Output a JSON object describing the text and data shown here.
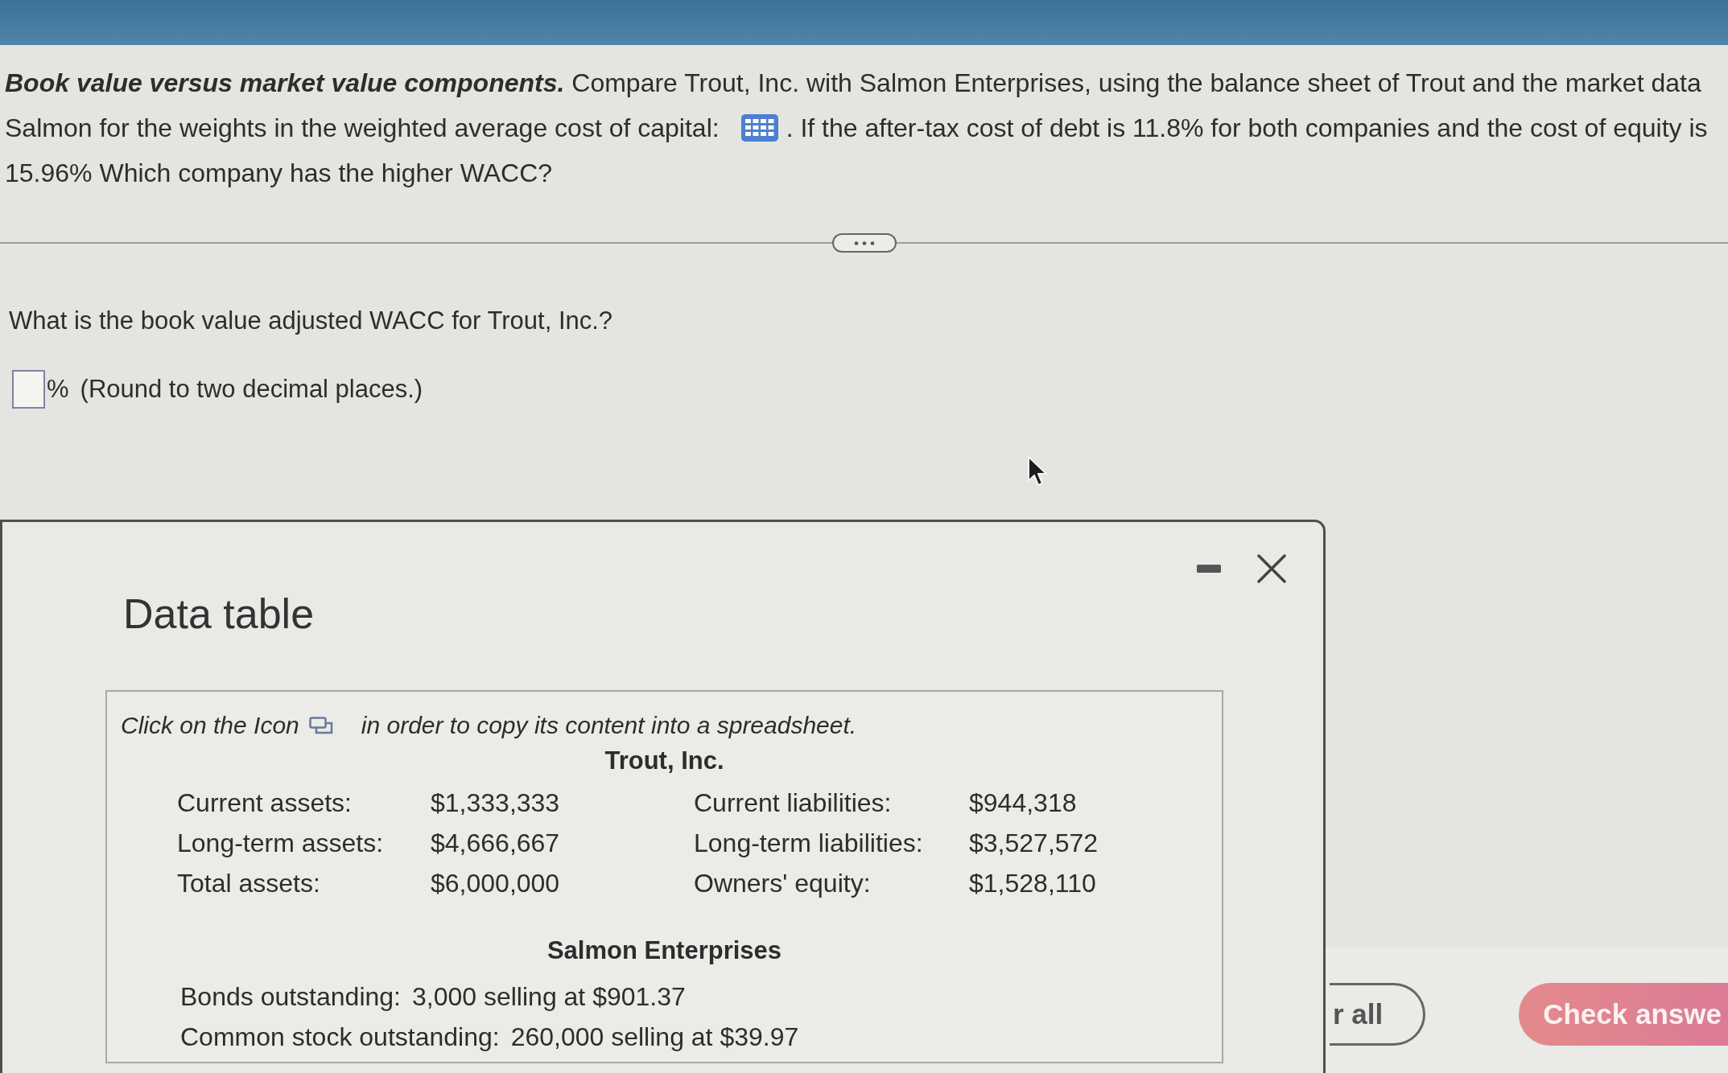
{
  "question": {
    "lines": [
      {
        "segments": [
          {
            "kind": "text",
            "text": "**Book value versus market value components.** Compare Trout, Inc. with Salmon Enterprises, using the balance sheet of Trout and the market data"
          }
        ]
      },
      {
        "segments": [
          {
            "kind": "text",
            "text": "Salmon for the weights in the weighted average cost of capital:"
          },
          {
            "kind": "table_icon"
          },
          {
            "kind": "text",
            "text": ". If the after-tax cost of debt is 11.8% for both companies and the cost of equity is"
          }
        ]
      },
      {
        "segments": [
          {
            "kind": "text",
            "text": "15.96% Which company has the higher WACC?"
          }
        ]
      }
    ]
  },
  "prompt": {
    "question": "What is the book value adjusted WACC for Trout, Inc.?",
    "unit": "%",
    "hint": "(Round to two decimal places.)"
  },
  "data_table": {
    "title": "Data table",
    "instruction_before": "Click on the Icon",
    "instruction_after": "in order to copy its content into a spreadsheet.",
    "trout": {
      "heading": "Trout, Inc.",
      "rows": [
        {
          "label": "Current assets:",
          "value": "$1,333,333",
          "label_2": "Current liabilities:",
          "value_2": "$944,318"
        },
        {
          "label": "Long-term assets:",
          "value": "$4,666,667",
          "label_2": "Long-term liabilities:",
          "value_2": "$3,527,572"
        },
        {
          "label": "Total assets:",
          "value": "$6,000,000",
          "label_2": "Owners' equity:",
          "value_2": "$1,528,110"
        }
      ]
    },
    "salmon": {
      "heading": "Salmon Enterprises",
      "rows": [
        {
          "label": "Bonds outstanding:",
          "value": "3,000 selling at $901.37"
        },
        {
          "label": "Common stock outstanding:",
          "value": "260,000 selling at $39.97"
        }
      ]
    }
  },
  "buttons": [
    {
      "label": "r all",
      "kind": "outline"
    },
    {
      "label": "Check answe",
      "kind": "primary"
    }
  ]
}
